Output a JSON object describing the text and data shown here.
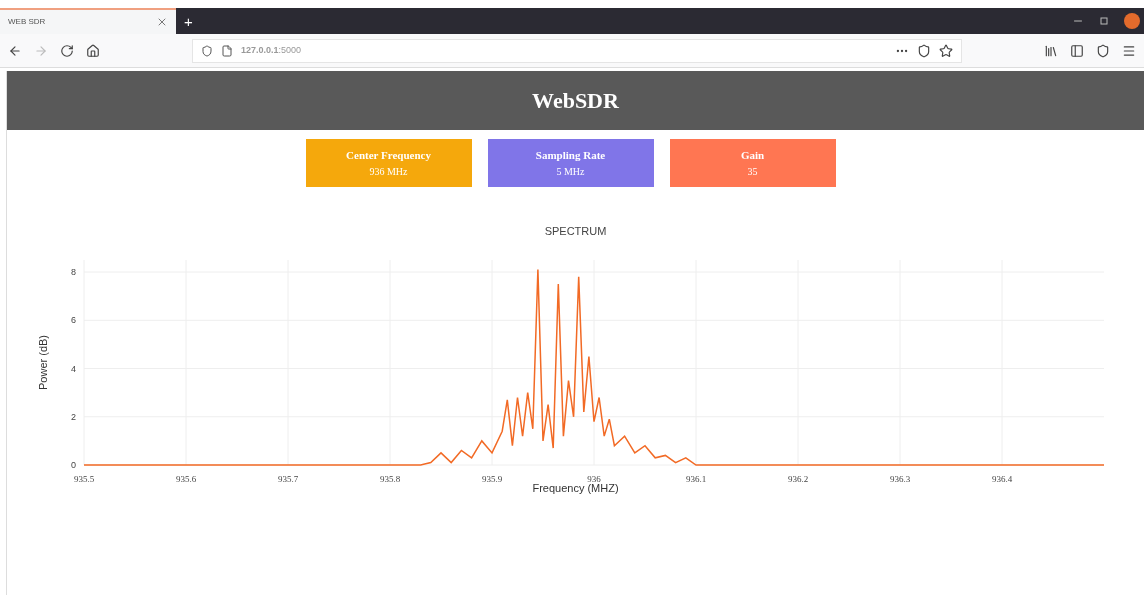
{
  "browser": {
    "tab_title": "WEB SDR",
    "new_tab": "+",
    "url": "**127.0.0.1**:5000"
  },
  "header": {
    "title": "WebSDR"
  },
  "cards": [
    {
      "label": "Center Frequency",
      "value": "936 MHz",
      "color": "#f5a80c"
    },
    {
      "label": "Sampling Rate",
      "value": "5 MHz",
      "color": "#8075e8"
    },
    {
      "label": "Gain",
      "value": "35",
      "color": "#ff7652"
    }
  ],
  "chart": {
    "chart_data": {
      "type": "line",
      "grid": true,
      "title": "SPECTRUM",
      "xlabel": "Frequency (MHZ)",
      "ylabel": "Power (dB)",
      "xlim": [
        935.5,
        936.5
      ],
      "ylim": [
        0,
        8.5
      ],
      "xticks": [
        935.5,
        935.6,
        935.7,
        935.8,
        935.9,
        {
          "value": 936,
          "label": "936"
        },
        936.1,
        936.2,
        936.3,
        936.4
      ],
      "yticks": [
        0,
        2,
        4,
        6,
        8
      ],
      "x": [
        935.5,
        935.83,
        935.84,
        935.85,
        935.86,
        935.87,
        935.88,
        935.89,
        935.9,
        935.91,
        935.915,
        935.92,
        935.925,
        935.93,
        935.935,
        935.94,
        935.945,
        935.95,
        935.955,
        935.96,
        935.965,
        935.97,
        935.975,
        935.98,
        935.985,
        935.99,
        935.995,
        936.0,
        936.005,
        936.01,
        936.015,
        936.02,
        936.03,
        936.04,
        936.05,
        936.06,
        936.07,
        936.08,
        936.09,
        936.1,
        936.5
      ],
      "series": [
        {
          "color": "#f26a25",
          "values": [
            0,
            0,
            0.1,
            0.5,
            0.1,
            0.6,
            0.3,
            1.0,
            0.5,
            1.4,
            2.7,
            0.8,
            2.8,
            1.2,
            3.0,
            1.5,
            8.1,
            1.0,
            2.5,
            0.7,
            7.5,
            1.2,
            3.5,
            2.0,
            7.8,
            2.2,
            4.5,
            1.8,
            2.8,
            1.2,
            1.9,
            0.8,
            1.2,
            0.5,
            0.8,
            0.3,
            0.4,
            0.1,
            0.3,
            0,
            0
          ]
        }
      ]
    }
  }
}
